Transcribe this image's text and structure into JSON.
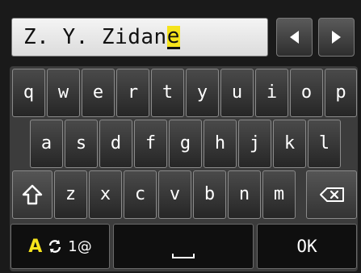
{
  "input": {
    "text_before_caret": "Z. Y. Zidan",
    "caret_char": "e"
  },
  "arrows": {
    "left_icon": "left-triangle-icon",
    "right_icon": "right-triangle-icon"
  },
  "keyboard": {
    "row1": [
      "q",
      "w",
      "e",
      "r",
      "t",
      "y",
      "u",
      "i",
      "o",
      "p"
    ],
    "row2": [
      "a",
      "s",
      "d",
      "f",
      "g",
      "h",
      "j",
      "k",
      "l"
    ],
    "row3": [
      "z",
      "x",
      "c",
      "v",
      "b",
      "n",
      "m"
    ],
    "shift_icon": "shift-arrow-icon",
    "backspace_icon": "backspace-icon"
  },
  "bottom": {
    "mode_current": "A",
    "mode_next": "1@",
    "mode_icon": "switch-cycle-icon",
    "space_icon": "space-icon",
    "ok_label": "OK"
  },
  "colors": {
    "accent_yellow": "#f5e31c",
    "key_border": "#8a8a8a",
    "background": "#1a1a1a"
  }
}
